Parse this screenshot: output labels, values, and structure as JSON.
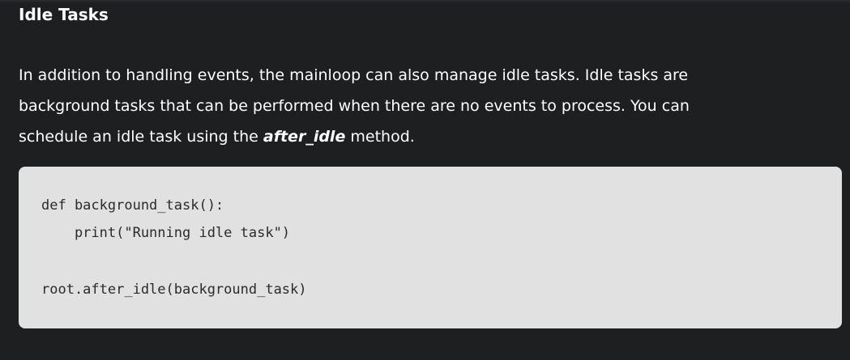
{
  "section": {
    "heading": "Idle Tasks",
    "paragraph": {
      "line1": "In addition to handling events, the mainloop can also manage idle tasks. Idle tasks are",
      "line2": "background tasks that can be performed when there are no events to process. You can",
      "line3_before": "schedule an idle task using the ",
      "line3_code": "after_idle",
      "line3_after": " method."
    }
  },
  "code_block": {
    "lines": [
      "def background_task():",
      "    print(\"Running idle task\")",
      "",
      "root.after_idle(background_task)"
    ]
  }
}
